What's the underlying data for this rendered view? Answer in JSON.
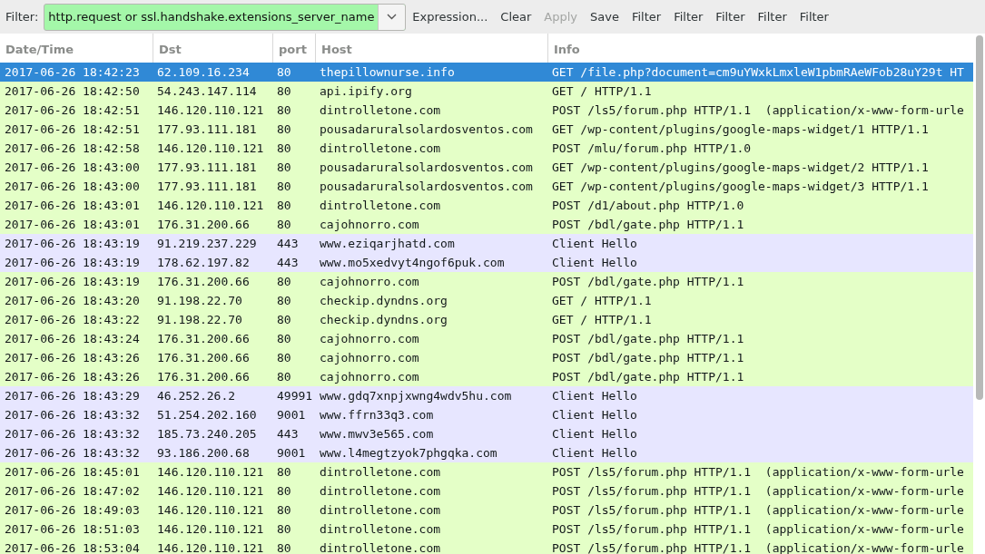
{
  "toolbar": {
    "filter_label": "Filter:",
    "filter_value": "http.request or ssl.handshake.extensions_server_name",
    "buttons": [
      {
        "label": "Expression...",
        "disabled": false
      },
      {
        "label": "Clear",
        "disabled": false
      },
      {
        "label": "Apply",
        "disabled": true
      },
      {
        "label": "Save",
        "disabled": false
      },
      {
        "label": "Filter",
        "disabled": false
      },
      {
        "label": "Filter",
        "disabled": false
      },
      {
        "label": "Filter",
        "disabled": false
      },
      {
        "label": "Filter",
        "disabled": false
      },
      {
        "label": "Filter",
        "disabled": false
      }
    ]
  },
  "table": {
    "columns": [
      "Date/Time",
      "Dst",
      "port",
      "Host",
      "Info"
    ],
    "rows": [
      {
        "kind": "http",
        "selected": true,
        "cells": [
          "2017-06-26 18:42:23",
          "62.109.16.234",
          "80",
          "thepillownurse.info",
          "GET /file.php?document=cm9uYWxkLmxleW1pbmRAeWFob28uY29t HT"
        ]
      },
      {
        "kind": "http",
        "selected": false,
        "cells": [
          "2017-06-26 18:42:50",
          "54.243.147.114",
          "80",
          "api.ipify.org",
          "GET / HTTP/1.1"
        ]
      },
      {
        "kind": "http",
        "selected": false,
        "cells": [
          "2017-06-26 18:42:51",
          "146.120.110.121",
          "80",
          "dintrolletone.com",
          "POST /ls5/forum.php HTTP/1.1  (application/x-www-form-urle"
        ]
      },
      {
        "kind": "http",
        "selected": false,
        "cells": [
          "2017-06-26 18:42:51",
          "177.93.111.181",
          "80",
          "pousadaruralsolardosventos.com",
          "GET /wp-content/plugins/google-maps-widget/1 HTTP/1.1"
        ]
      },
      {
        "kind": "http",
        "selected": false,
        "cells": [
          "2017-06-26 18:42:58",
          "146.120.110.121",
          "80",
          "dintrolletone.com",
          "POST /mlu/forum.php HTTP/1.0"
        ]
      },
      {
        "kind": "http",
        "selected": false,
        "cells": [
          "2017-06-26 18:43:00",
          "177.93.111.181",
          "80",
          "pousadaruralsolardosventos.com",
          "GET /wp-content/plugins/google-maps-widget/2 HTTP/1.1"
        ]
      },
      {
        "kind": "http",
        "selected": false,
        "cells": [
          "2017-06-26 18:43:00",
          "177.93.111.181",
          "80",
          "pousadaruralsolardosventos.com",
          "GET /wp-content/plugins/google-maps-widget/3 HTTP/1.1"
        ]
      },
      {
        "kind": "http",
        "selected": false,
        "cells": [
          "2017-06-26 18:43:01",
          "146.120.110.121",
          "80",
          "dintrolletone.com",
          "POST /d1/about.php HTTP/1.0"
        ]
      },
      {
        "kind": "http",
        "selected": false,
        "cells": [
          "2017-06-26 18:43:01",
          "176.31.200.66",
          "80",
          "cajohnorro.com",
          "POST /bdl/gate.php HTTP/1.1"
        ]
      },
      {
        "kind": "tls",
        "selected": false,
        "cells": [
          "2017-06-26 18:43:19",
          "91.219.237.229",
          "443",
          "www.eziqarjhatd.com",
          "Client Hello"
        ]
      },
      {
        "kind": "tls",
        "selected": false,
        "cells": [
          "2017-06-26 18:43:19",
          "178.62.197.82",
          "443",
          "www.mo5xedvyt4ngof6puk.com",
          "Client Hello"
        ]
      },
      {
        "kind": "http",
        "selected": false,
        "cells": [
          "2017-06-26 18:43:19",
          "176.31.200.66",
          "80",
          "cajohnorro.com",
          "POST /bdl/gate.php HTTP/1.1"
        ]
      },
      {
        "kind": "http",
        "selected": false,
        "cells": [
          "2017-06-26 18:43:20",
          "91.198.22.70",
          "80",
          "checkip.dyndns.org",
          "GET / HTTP/1.1"
        ]
      },
      {
        "kind": "http",
        "selected": false,
        "cells": [
          "2017-06-26 18:43:22",
          "91.198.22.70",
          "80",
          "checkip.dyndns.org",
          "GET / HTTP/1.1"
        ]
      },
      {
        "kind": "http",
        "selected": false,
        "cells": [
          "2017-06-26 18:43:24",
          "176.31.200.66",
          "80",
          "cajohnorro.com",
          "POST /bdl/gate.php HTTP/1.1"
        ]
      },
      {
        "kind": "http",
        "selected": false,
        "cells": [
          "2017-06-26 18:43:26",
          "176.31.200.66",
          "80",
          "cajohnorro.com",
          "POST /bdl/gate.php HTTP/1.1"
        ]
      },
      {
        "kind": "http",
        "selected": false,
        "cells": [
          "2017-06-26 18:43:26",
          "176.31.200.66",
          "80",
          "cajohnorro.com",
          "POST /bdl/gate.php HTTP/1.1"
        ]
      },
      {
        "kind": "tls",
        "selected": false,
        "cells": [
          "2017-06-26 18:43:29",
          "46.252.26.2",
          "49991",
          "www.gdq7xnpjxwng4wdv5hu.com",
          "Client Hello"
        ]
      },
      {
        "kind": "tls",
        "selected": false,
        "cells": [
          "2017-06-26 18:43:32",
          "51.254.202.160",
          "9001",
          "www.ffrn33q3.com",
          "Client Hello"
        ]
      },
      {
        "kind": "tls",
        "selected": false,
        "cells": [
          "2017-06-26 18:43:32",
          "185.73.240.205",
          "443",
          "www.mwv3e565.com",
          "Client Hello"
        ]
      },
      {
        "kind": "tls",
        "selected": false,
        "cells": [
          "2017-06-26 18:43:32",
          "93.186.200.68",
          "9001",
          "www.l4megtzyok7phgqka.com",
          "Client Hello"
        ]
      },
      {
        "kind": "http",
        "selected": false,
        "cells": [
          "2017-06-26 18:45:01",
          "146.120.110.121",
          "80",
          "dintrolletone.com",
          "POST /ls5/forum.php HTTP/1.1  (application/x-www-form-urle"
        ]
      },
      {
        "kind": "http",
        "selected": false,
        "cells": [
          "2017-06-26 18:47:02",
          "146.120.110.121",
          "80",
          "dintrolletone.com",
          "POST /ls5/forum.php HTTP/1.1  (application/x-www-form-urle"
        ]
      },
      {
        "kind": "http",
        "selected": false,
        "cells": [
          "2017-06-26 18:49:03",
          "146.120.110.121",
          "80",
          "dintrolletone.com",
          "POST /ls5/forum.php HTTP/1.1  (application/x-www-form-urle"
        ]
      },
      {
        "kind": "http",
        "selected": false,
        "cells": [
          "2017-06-26 18:51:03",
          "146.120.110.121",
          "80",
          "dintrolletone.com",
          "POST /ls5/forum.php HTTP/1.1  (application/x-www-form-urle"
        ]
      },
      {
        "kind": "http",
        "selected": false,
        "cells": [
          "2017-06-26 18:53:04",
          "146.120.110.121",
          "80",
          "dintrolletone.com",
          "POST /ls5/forum.php HTTP/1.1  (application/x-www-form-urle"
        ]
      }
    ]
  }
}
